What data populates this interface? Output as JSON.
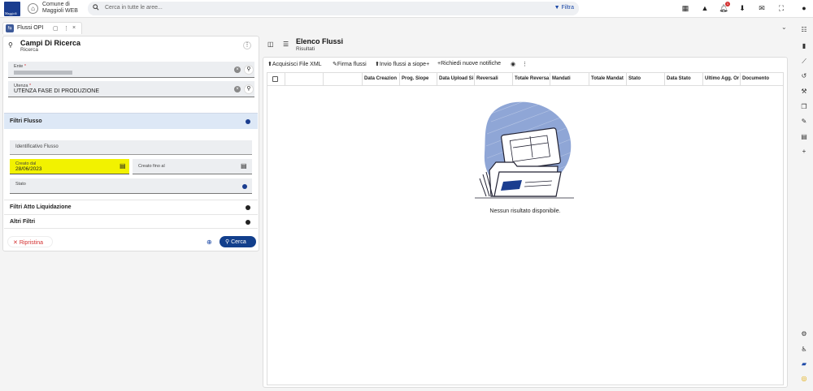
{
  "app": {
    "logo_text": "Maggioli",
    "comune_line1": "Comune di",
    "comune_line2": "Maggioli WEB"
  },
  "search": {
    "placeholder": "Cerca in tutte le aree...",
    "filter_label": "Filtra"
  },
  "notifications": {
    "count": "1"
  },
  "tab": {
    "label": "Flussi OPI"
  },
  "left": {
    "title": "Campi Di Ricerca",
    "subtitle": "Ricerca",
    "ente_label": "Ente",
    "ente_value": "",
    "utenza_label": "Utenza",
    "utenza_value": "UTENZA FASE DI PRODUZIONE",
    "filtri_flusso": "Filtri Flusso",
    "identificativo_label": "Identificativo Flusso",
    "creato_dal_label": "Creato dal",
    "creato_dal_value": "28/06/2023",
    "creato_fino_label": "Creato fino al",
    "stato_label": "Stato",
    "filtri_atto": "Filtri Atto Liquidazione",
    "altri_filtri": "Altri Filtri",
    "ripristina": "Ripristina",
    "cerca": "Cerca"
  },
  "right": {
    "title": "Elenco Flussi",
    "subtitle": "Risultati",
    "toolbar": [
      "Acquisisci File XML",
      "Firma flussi",
      "Invio flussi a siope+",
      "Richiedi nuove notifiche"
    ],
    "columns": [
      "Data Creazion",
      "Prog. Siope",
      "Data Upload Si",
      "Reversali",
      "Totale Reversa",
      "Mandati",
      "Totale Mandat",
      "Stato",
      "Data Stato",
      "Ultimo Agg. Or",
      "Documento"
    ],
    "empty": "Nessun risultato disponibile."
  },
  "colors": {
    "accent": "#1a47a6",
    "primary_button": "#123f8c",
    "highlight": "#f2f200",
    "danger": "#d32f2f",
    "section_bg": "#dde8f6"
  }
}
